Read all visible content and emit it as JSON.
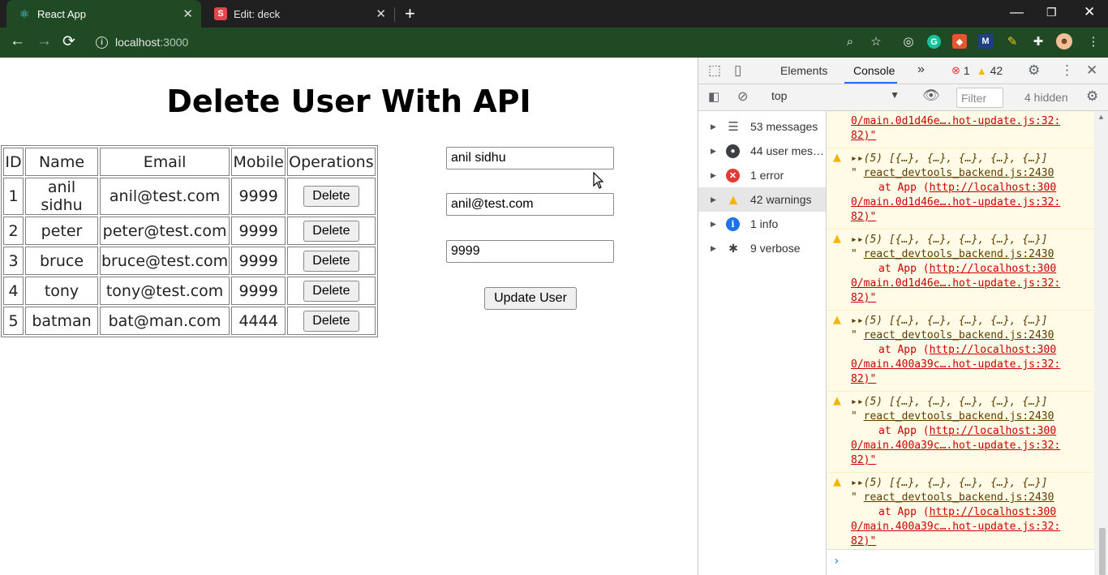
{
  "browser": {
    "tabs": [
      {
        "title": "React App",
        "favicon": "react-icon"
      },
      {
        "title": "Edit: deck",
        "favicon": "deck-icon"
      }
    ],
    "url_host": "localhost",
    "url_port": ":3000"
  },
  "app": {
    "title": "Delete User With API",
    "table": {
      "headers": [
        "ID",
        "Name",
        "Email",
        "Mobile",
        "Operations"
      ],
      "rows": [
        {
          "id": "1",
          "name": "anil sidhu",
          "email": "anil@test.com",
          "mobile": "9999",
          "action": "Delete"
        },
        {
          "id": "2",
          "name": "peter",
          "email": "peter@test.com",
          "mobile": "9999",
          "action": "Delete"
        },
        {
          "id": "3",
          "name": "bruce",
          "email": "bruce@test.com",
          "mobile": "9999",
          "action": "Delete"
        },
        {
          "id": "4",
          "name": "tony",
          "email": "tony@test.com",
          "mobile": "9999",
          "action": "Delete"
        },
        {
          "id": "5",
          "name": "batman",
          "email": "bat@man.com",
          "mobile": "4444",
          "action": "Delete"
        }
      ]
    },
    "form": {
      "name_value": "anil sidhu",
      "email_value": "anil@test.com",
      "mobile_value": "9999",
      "update_label": "Update User"
    }
  },
  "devtools": {
    "tabs": {
      "elements": "Elements",
      "console": "Console",
      "more": "»"
    },
    "error_count": "1",
    "warning_count": "42",
    "context": "top",
    "filter_placeholder": "Filter",
    "hidden": "4 hidden",
    "sidebar": [
      {
        "label": "53 messages",
        "icon": "list-icon"
      },
      {
        "label": "44 user mes…",
        "icon": "user-icon"
      },
      {
        "label": "1 error",
        "icon": "error-icon"
      },
      {
        "label": "42 warnings",
        "icon": "warning-icon"
      },
      {
        "label": "1 info",
        "icon": "info-icon"
      },
      {
        "label": "9 verbose",
        "icon": "bug-icon"
      }
    ],
    "console": {
      "top_partial": [
        "0/main.0d1d46e….hot-update.js:32:",
        "82)\""
      ],
      "messages": [
        {
          "array": "(5) [{…}, {…}, {…}, {…}, {…}]",
          "source": "react_devtools_backend.js:2430",
          "at": "at App (",
          "url1": "http://localhost:300",
          "url2": "0/main.0d1d46e….hot-update.js:32:",
          "url3": "82)\""
        },
        {
          "array": "(5) [{…}, {…}, {…}, {…}, {…}]",
          "source": "react_devtools_backend.js:2430",
          "at": "at App (",
          "url1": "http://localhost:300",
          "url2": "0/main.0d1d46e….hot-update.js:32:",
          "url3": "82)\""
        },
        {
          "array": "(5) [{…}, {…}, {…}, {…}, {…}]",
          "source": "react_devtools_backend.js:2430",
          "at": "at App (",
          "url1": "http://localhost:300",
          "url2": "0/main.400a39c….hot-update.js:32:",
          "url3": "82)\""
        },
        {
          "array": "(5) [{…}, {…}, {…}, {…}, {…}]",
          "source": "react_devtools_backend.js:2430",
          "at": "at App (",
          "url1": "http://localhost:300",
          "url2": "0/main.400a39c….hot-update.js:32:",
          "url3": "82)\""
        },
        {
          "array": "(5) [{…}, {…}, {…}, {…}, {…}]",
          "source": "react_devtools_backend.js:2430",
          "at": "at App (",
          "url1": "http://localhost:300",
          "url2": "0/main.400a39c….hot-update.js:32:",
          "url3": "82)\""
        }
      ],
      "prompt": "›"
    }
  }
}
